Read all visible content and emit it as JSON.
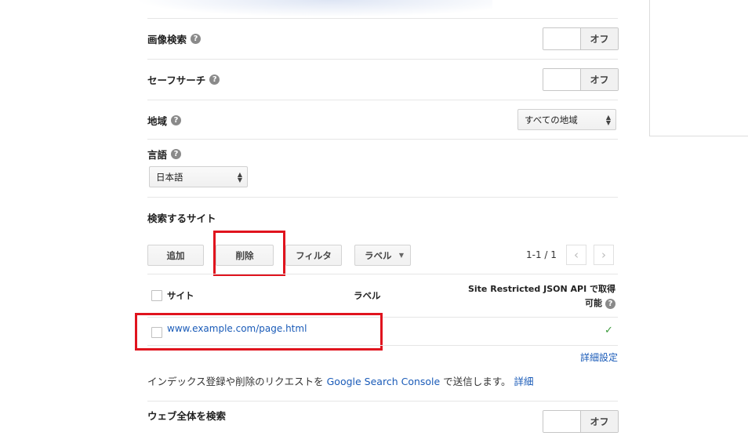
{
  "image_search": {
    "label": "画像検索",
    "toggle": "オフ"
  },
  "safe_search": {
    "label": "セーフサーチ",
    "toggle": "オフ"
  },
  "region": {
    "label": "地域",
    "value": "すべての地域"
  },
  "language": {
    "label": "言語",
    "value": "日本語"
  },
  "sites": {
    "heading": "検索するサイト",
    "buttons": {
      "add": "追加",
      "delete": "削除",
      "filter": "フィルタ",
      "label": "ラベル"
    },
    "pagination": "1-1 / 1",
    "columns": {
      "site": "サイト",
      "label": "ラベル",
      "api_line1": "Site Restricted JSON API で取得",
      "api_line2": "可能"
    },
    "rows": [
      {
        "site": "www.example.com/page.html",
        "api": "✓"
      }
    ],
    "advanced_link": "詳細設定"
  },
  "index_note": {
    "text_before": "インデックス登録や削除のリクエストを",
    "link": "Google Search Console",
    "text_after": "で送信します。",
    "details_link": "詳細"
  },
  "web_search": {
    "label": "ウェブ全体を検索",
    "toggle": "オフ"
  },
  "colors": {
    "link": "#1a5bb8",
    "highlight": "#e0141e",
    "check": "#3a9a3a"
  }
}
